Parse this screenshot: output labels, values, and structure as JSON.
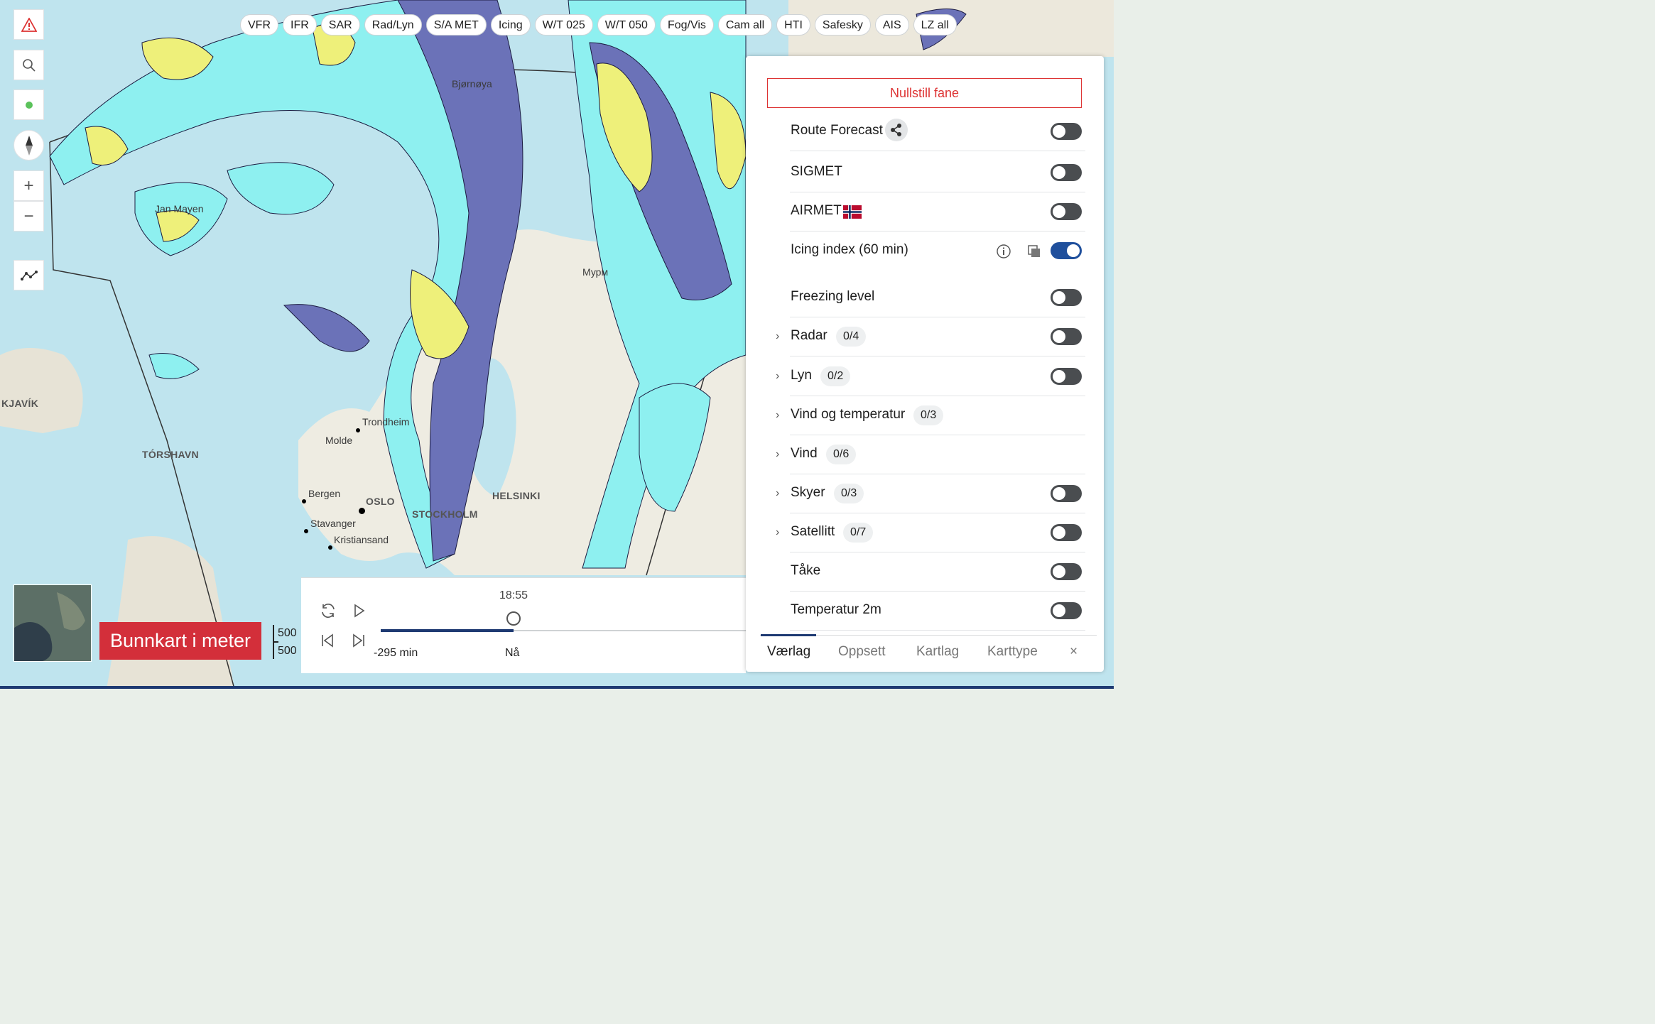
{
  "chips": [
    "VFR",
    "IFR",
    "SAR",
    "Rad/Lyn",
    "S/A MET",
    "Icing",
    "W/T 025",
    "W/T 050",
    "Fog/Vis",
    "Cam all",
    "HTI",
    "Safesky",
    "AIS",
    "LZ all"
  ],
  "left_toolbar": {
    "warning_icon": "warning-triangle-icon",
    "search_icon": "search-icon",
    "location_icon": "location-dot-icon",
    "compass_icon": "compass-icon",
    "zoom_in": "+",
    "zoom_out": "−",
    "route_icon": "route-graph-icon"
  },
  "map_labels": {
    "bjornoya": "Bjørnøya",
    "jan_mayen": "Jan Mayen",
    "reykjavik": "KJAVÍK",
    "torshavn": "TÓRSHAVN",
    "trondheim": "Trondheim",
    "molde": "Molde",
    "bergen": "Bergen",
    "oslo": "OSLO",
    "stavanger": "Stavanger",
    "kristiansand": "Kristiansand",
    "stockholm": "STOCKHOLM",
    "helsinki": "HELSINKI",
    "murmansk": "Мурм"
  },
  "panel": {
    "reset_label": "Nullstill fane",
    "layers": [
      {
        "name": "Route Forecast",
        "share": true,
        "toggle": "off"
      },
      {
        "name": "SIGMET",
        "toggle": "off"
      },
      {
        "name": "AIRMET",
        "flag": true,
        "toggle": "off"
      },
      {
        "name": "Icing index (60 min)",
        "info": true,
        "copy": true,
        "toggle": "on"
      },
      {
        "name": "Freezing level",
        "toggle": "off"
      },
      {
        "name": "Radar",
        "badge": "0/4",
        "expandable": true,
        "toggle": "off"
      },
      {
        "name": "Lyn",
        "badge": "0/2",
        "expandable": true,
        "toggle": "off"
      },
      {
        "name": "Vind og temperatur",
        "badge": "0/3",
        "expandable": true
      },
      {
        "name": "Vind",
        "badge": "0/6",
        "expandable": true
      },
      {
        "name": "Skyer",
        "badge": "0/3",
        "expandable": true,
        "toggle": "off"
      },
      {
        "name": "Satellitt",
        "badge": "0/7",
        "expandable": true,
        "toggle": "off"
      },
      {
        "name": "Tåke",
        "toggle": "off"
      },
      {
        "name": "Temperatur 2m",
        "toggle": "off"
      }
    ],
    "tabs": {
      "weather": "Værlag",
      "setup": "Oppsett",
      "maplayers": "Kartlag",
      "maptype": "Karttype",
      "close": "×",
      "active": "Værlag"
    }
  },
  "timeline": {
    "current_time": "18:55",
    "start_label": "-295 min",
    "now_label": "Nå",
    "position_fraction": 1.0
  },
  "basemap": {
    "banner": "Bunnkart i meter",
    "scale_top": "500",
    "scale_bottom": "500"
  },
  "colors": {
    "accent_red": "#d33",
    "toggle_on": "#1f4f9c",
    "icing_light": "#8ef0f0",
    "icing_mid": "#6b72b8",
    "icing_heavy": "#eef07a"
  }
}
